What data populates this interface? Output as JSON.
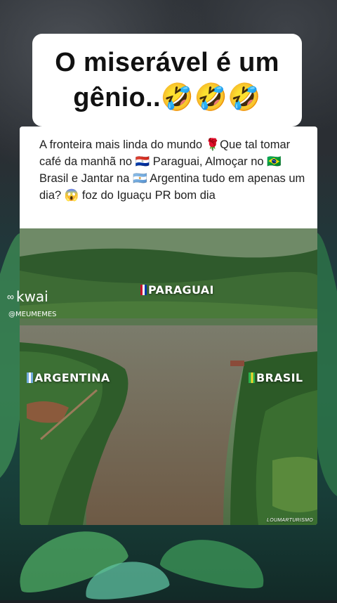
{
  "header": {
    "title_line1": "O miserável é um",
    "title_line2": "gênio..🤣🤣🤣"
  },
  "post": {
    "caption": "A fronteira mais linda do mundo 🌹Que tal tomar café da manhã no 🇵🇾  Paraguai, Almoçar no 🇧🇷  Brasil e Jantar na 🇦🇷 Argentina tudo em apenas um dia? 😱 foz do Iguaçu PR bom dia"
  },
  "photo": {
    "label_paraguai": "PARAGUAI",
    "label_argentina": "ARGENTINA",
    "label_brasil": "BRASIL",
    "credit": "LOUMARTURISMO"
  },
  "watermark": {
    "app": "kwai",
    "handle": "@MEUMEMES"
  },
  "colors": {
    "paraguai_flag": "#c8102e",
    "argentina_flag": "#74acdf",
    "brasil_flag": "#2bb24c"
  }
}
